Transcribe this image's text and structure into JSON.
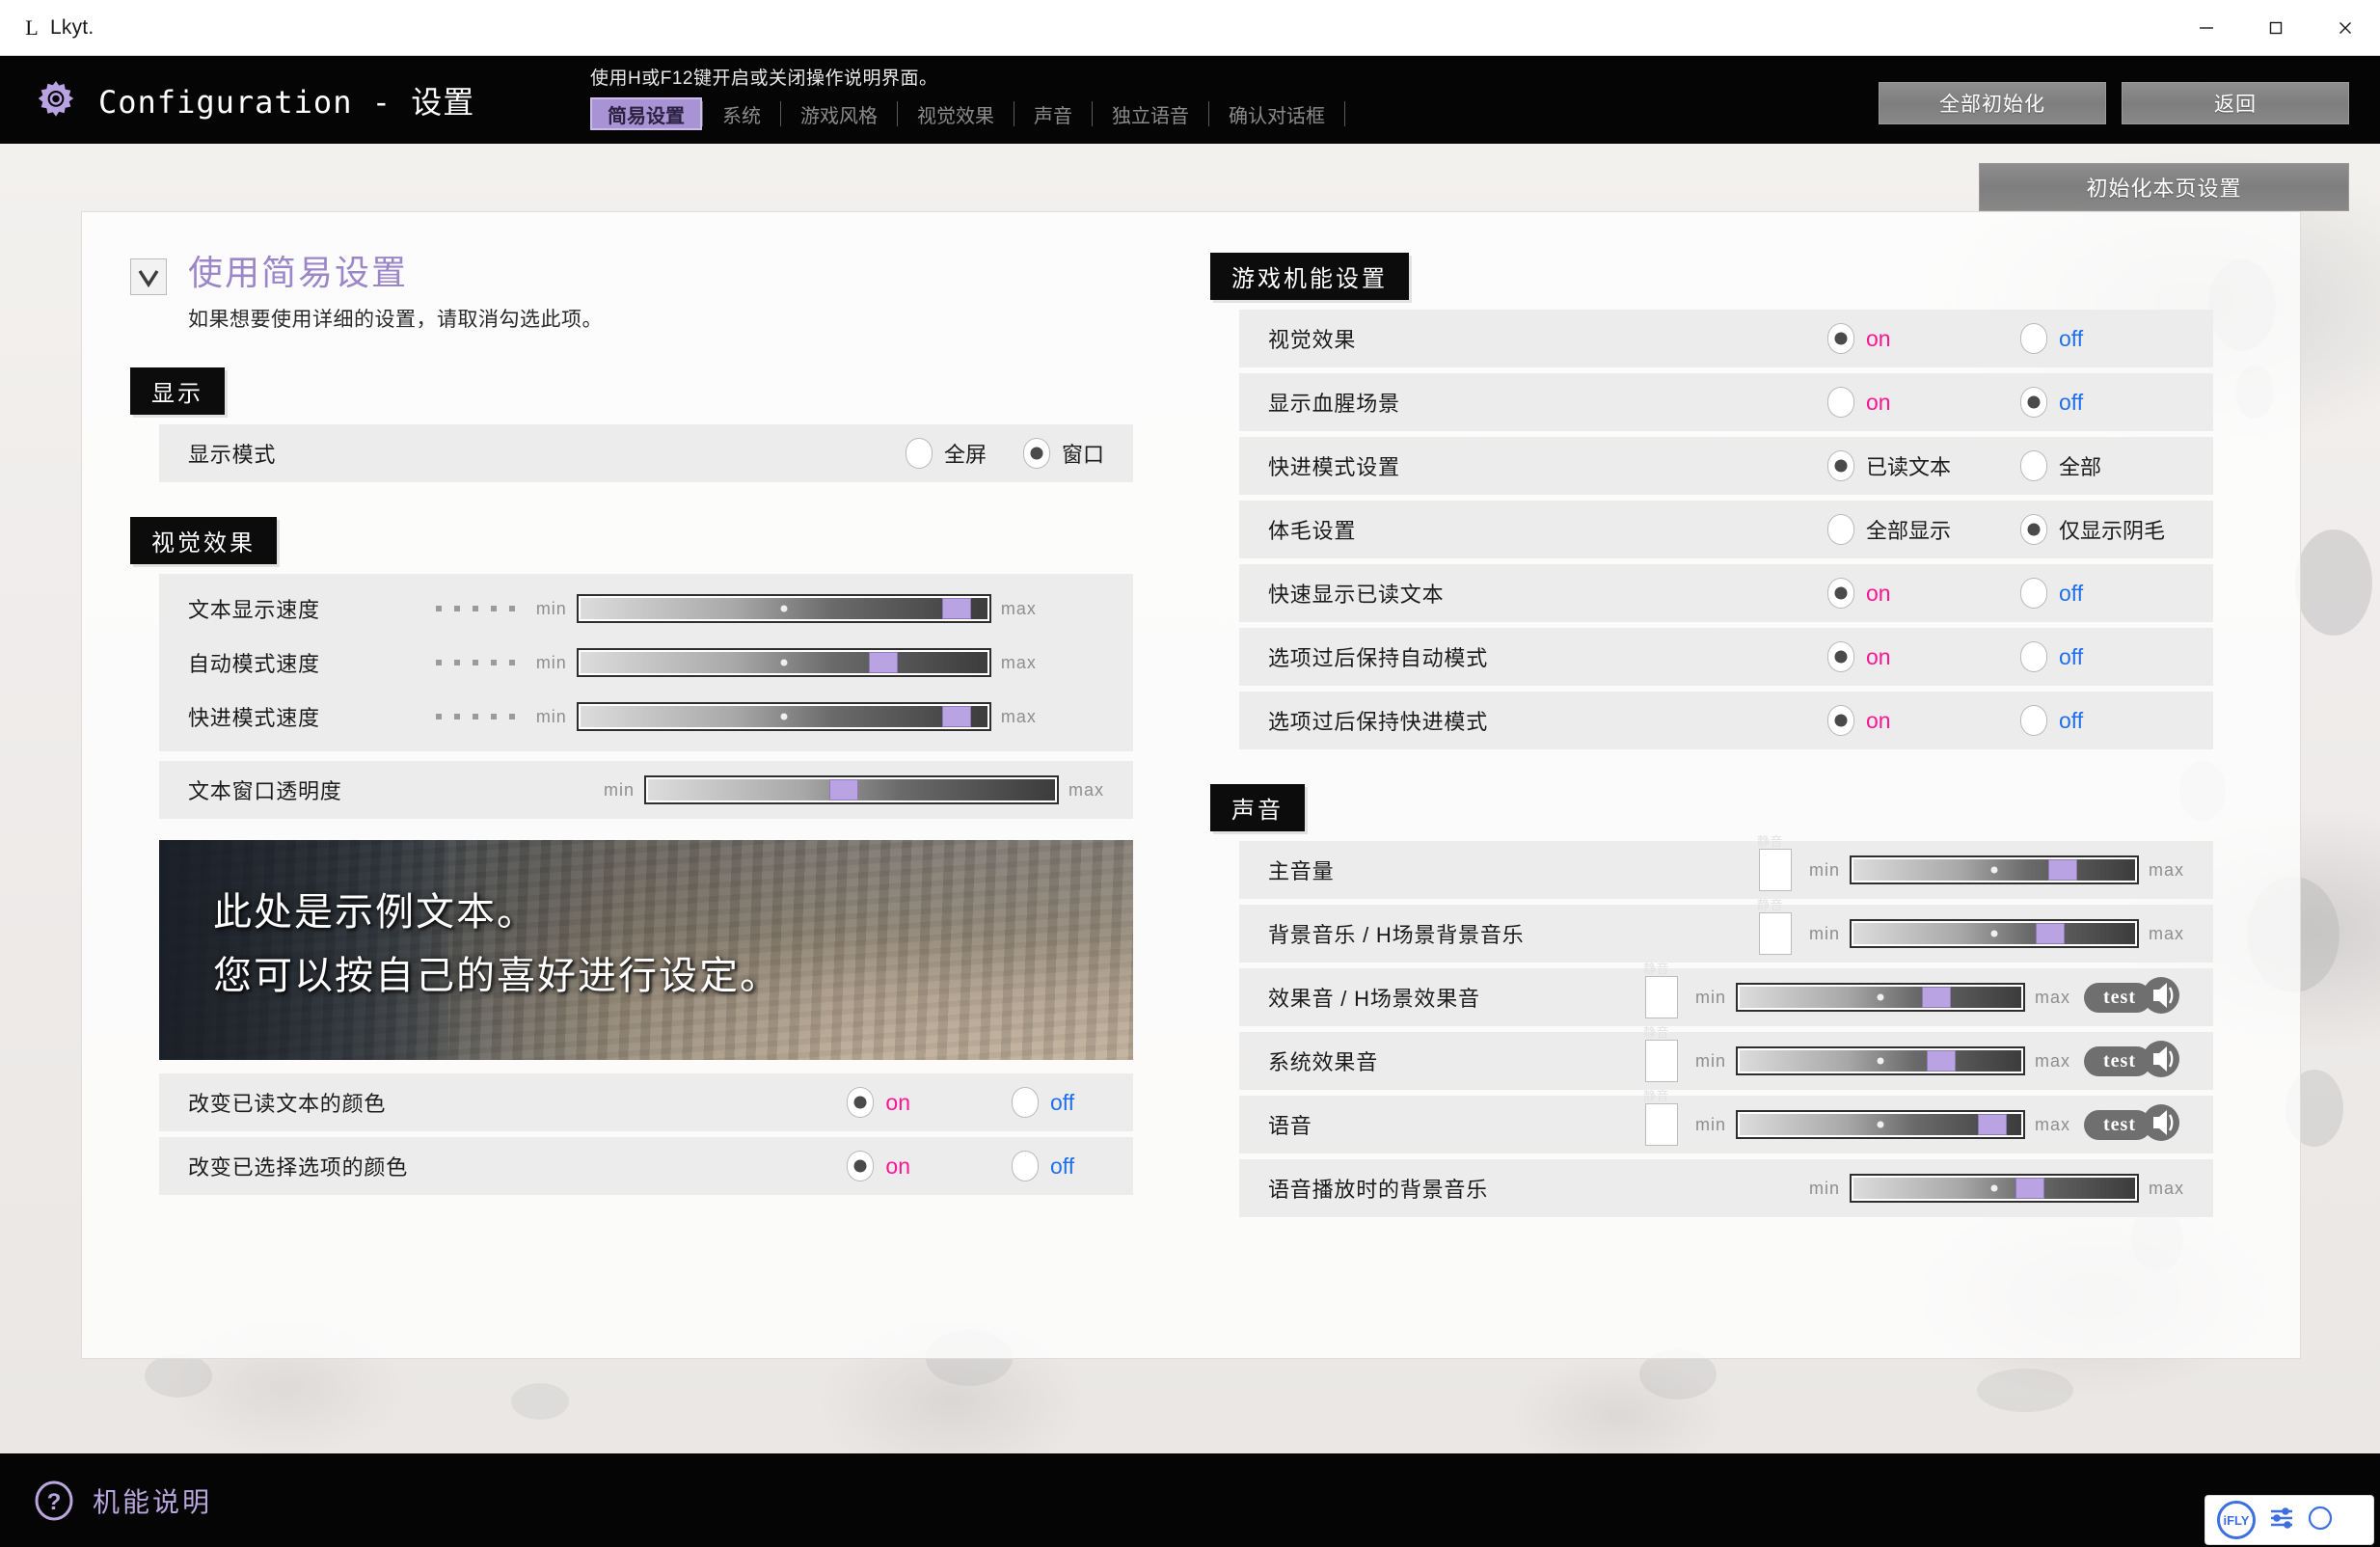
{
  "window": {
    "title": "Lkyt.",
    "logo_glyph": "L",
    "minimize": "—",
    "maximize": "□",
    "close": "✕"
  },
  "header": {
    "brand": "Configuration - 设置",
    "hint": "使用H或F12键开启或关闭操作说明界面。",
    "tabs": [
      {
        "label": "简易设置",
        "active": true
      },
      {
        "label": "系统",
        "active": false
      },
      {
        "label": "游戏风格",
        "active": false
      },
      {
        "label": "视觉效果",
        "active": false
      },
      {
        "label": "声音",
        "active": false
      },
      {
        "label": "独立语音",
        "active": false
      },
      {
        "label": "确认对话框",
        "active": false
      }
    ],
    "reset_all": "全部初始化",
    "back": "返回",
    "reset_page": "初始化本页设置"
  },
  "left": {
    "easy_mode": {
      "checked": true,
      "title": "使用简易设置",
      "subtitle": "如果想要使用详细的设置，请取消勾选此项。"
    },
    "display_section": "显示",
    "display_mode": {
      "label": "显示模式",
      "option_a": "全屏",
      "option_b": "窗口",
      "selected": "b"
    },
    "visual_section": "视觉效果",
    "sliders": [
      {
        "label": "文本显示速度",
        "min": "min",
        "max": "max",
        "value": 95,
        "dots": 5
      },
      {
        "label": "自动模式速度",
        "min": "min",
        "max": "max",
        "value": 74,
        "dots": 5
      },
      {
        "label": "快进模式速度",
        "min": "min",
        "max": "max",
        "value": 95,
        "dots": 5
      }
    ],
    "opacity_slider": {
      "label": "文本窗口透明度",
      "min": "min",
      "max": "max",
      "value": 48
    },
    "preview": {
      "line1": "此处是示例文本。",
      "line2": "您可以按自己的喜好进行设定。"
    },
    "color_rows": [
      {
        "label": "改变已读文本的颜色",
        "on": "on",
        "off": "off",
        "selected": "on"
      },
      {
        "label": "改变已选择选项的颜色",
        "on": "on",
        "off": "off",
        "selected": "on"
      }
    ]
  },
  "right": {
    "game_section": "游戏机能设置",
    "game_rows": [
      {
        "label": "视觉效果",
        "option_a": "on",
        "option_b": "off",
        "selected": "a",
        "kind": "onoff"
      },
      {
        "label": "显示血腥场景",
        "option_a": "on",
        "option_b": "off",
        "selected": "b",
        "kind": "onoff"
      },
      {
        "label": "快进模式设置",
        "option_a": "已读文本",
        "option_b": "全部",
        "selected": "a",
        "kind": "text"
      },
      {
        "label": "体毛设置",
        "option_a": "全部显示",
        "option_b": "仅显示阴毛",
        "selected": "b",
        "kind": "text"
      },
      {
        "label": "快速显示已读文本",
        "option_a": "on",
        "option_b": "off",
        "selected": "a",
        "kind": "onoff"
      },
      {
        "label": "选项过后保持自动模式",
        "option_a": "on",
        "option_b": "off",
        "selected": "a",
        "kind": "onoff"
      },
      {
        "label": "选项过后保持快进模式",
        "option_a": "on",
        "option_b": "off",
        "selected": "a",
        "kind": "onoff"
      }
    ],
    "sound_section": "声音",
    "mute_caption": "静音",
    "test_label": "test",
    "sound_rows": [
      {
        "label": "主音量",
        "mute": false,
        "min": "min",
        "max": "max",
        "value": 75,
        "test": false
      },
      {
        "label": "背景音乐 / H场景背景音乐",
        "mute": false,
        "min": "min",
        "max": "max",
        "value": 70,
        "test": false
      },
      {
        "label": "效果音 / H场景效果音",
        "mute": false,
        "min": "min",
        "max": "max",
        "value": 70,
        "test": true
      },
      {
        "label": "系统效果音",
        "mute": false,
        "min": "min",
        "max": "max",
        "value": 72,
        "test": true
      },
      {
        "label": "语音",
        "mute": false,
        "min": "min",
        "max": "max",
        "value": 93,
        "test": true
      },
      {
        "label": "语音播放时的背景音乐",
        "mute": null,
        "min": "min",
        "max": "max",
        "value": 62,
        "test": false
      }
    ]
  },
  "footer": {
    "help_label": "机能说明",
    "help_icon": "?"
  },
  "ime": {
    "brand": "iFLY"
  },
  "colors": {
    "accent_purple": "#9a86c8",
    "thumb_purple": "#b9a3e3",
    "on_pink": "#ff1493",
    "off_blue": "#1f6fea",
    "header_black": "#050505",
    "tab_active_bg": "#a894d4"
  }
}
